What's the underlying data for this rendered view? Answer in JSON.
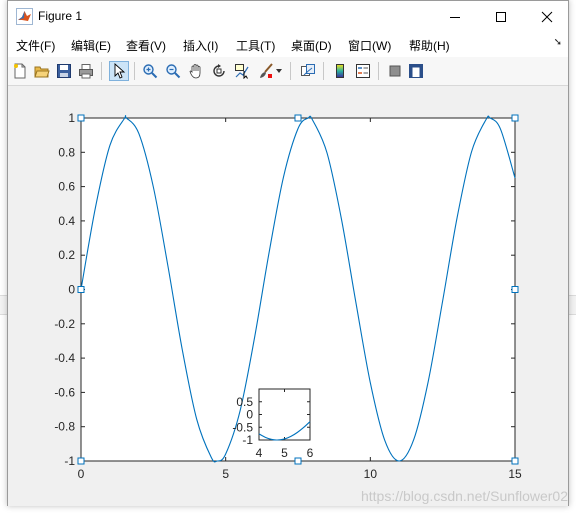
{
  "window": {
    "title": "Figure 1",
    "controls": {
      "minimize": "—",
      "maximize": "☐",
      "close": "✕"
    }
  },
  "menu": {
    "items": [
      "文件(F)",
      "编辑(E)",
      "查看(V)",
      "插入(I)",
      "工具(T)",
      "桌面(D)",
      "窗口(W)",
      "帮助(H)"
    ],
    "overflow_icon": "arrow-icon"
  },
  "toolbar": {
    "buttons": [
      "new-figure-icon",
      "open-file-icon",
      "save-icon",
      "print-icon",
      "edit-plot-arrow-icon",
      "zoom-in-icon",
      "zoom-out-icon",
      "pan-hand-icon",
      "rotate-3d-icon",
      "data-cursor-icon",
      "brush-icon",
      "brush-dropdown-icon",
      "link-plot-icon",
      "colorbar-icon",
      "legend-icon",
      "hide-plot-tools-icon",
      "show-plot-tools-icon"
    ]
  },
  "chart_data": [
    {
      "type": "line",
      "series": [
        {
          "x": [
            0,
            0.5,
            1,
            1.5,
            1.57,
            2,
            2.5,
            3,
            3.5,
            4,
            4.5,
            4.71,
            5,
            5.5,
            6,
            6.5,
            7,
            7.5,
            7.85,
            8,
            8.5,
            9,
            9.5,
            10,
            10.5,
            11,
            11.5,
            12,
            12.5,
            13,
            13.5,
            14,
            14.14,
            14.5,
            15
          ],
          "y": [
            0,
            0.479,
            0.841,
            0.997,
            1,
            0.909,
            0.598,
            0.141,
            -0.351,
            -0.757,
            -0.978,
            -1,
            -0.959,
            -0.706,
            -0.279,
            0.215,
            0.657,
            0.938,
            1,
            0.989,
            0.798,
            0.412,
            -0.075,
            -0.544,
            -0.88,
            -1,
            -0.875,
            -0.537,
            -0.066,
            0.42,
            0.804,
            0.991,
            1,
            0.935,
            0.65
          ],
          "color": "#0072bd"
        }
      ],
      "xlim": [
        0,
        15
      ],
      "ylim": [
        -1,
        1
      ],
      "xticks": [
        "0",
        "5",
        "10",
        "15"
      ],
      "yticks": [
        "-1",
        "-0.8",
        "-0.6",
        "-0.4",
        "-0.2",
        "0",
        "0.2",
        "0.4",
        "0.6",
        "0.8",
        "1"
      ],
      "grid": false,
      "selected": true
    },
    {
      "type": "line",
      "series": [
        {
          "x": [
            4,
            4.25,
            4.5,
            4.71,
            5,
            5.25,
            5.5,
            5.75,
            6
          ],
          "y": [
            -0.757,
            -0.895,
            -0.978,
            -1,
            -0.959,
            -0.859,
            -0.706,
            -0.509,
            -0.279
          ],
          "color": "#0072bd"
        }
      ],
      "xlim": [
        4,
        6
      ],
      "ylim": [
        -1,
        1
      ],
      "xticks": [
        "4",
        "5",
        "6"
      ],
      "yticks": [
        "-1",
        "-0.5",
        "0",
        "0.5"
      ],
      "grid": false
    }
  ],
  "watermark": "https://blog.csdn.net/Sunflower02"
}
